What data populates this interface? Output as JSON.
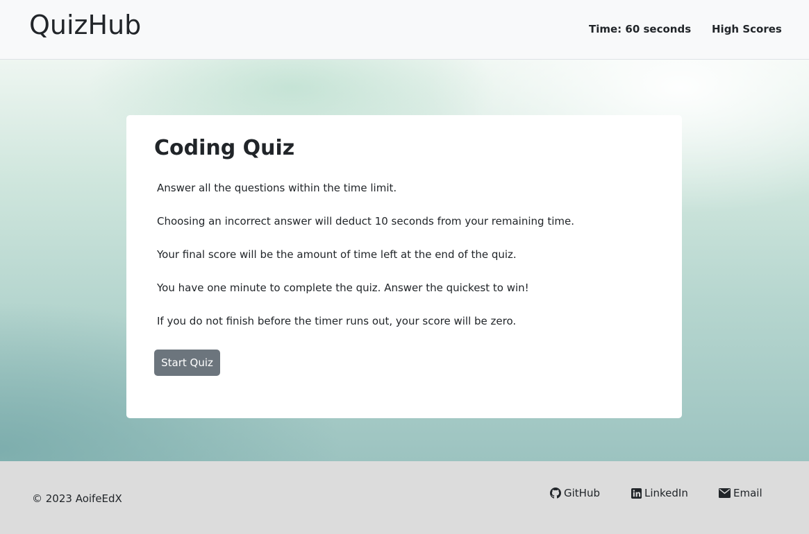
{
  "header": {
    "brand": "QuizHub",
    "timer_text": "Time: 60 seconds",
    "high_scores_label": "High Scores"
  },
  "quiz": {
    "title": "Coding Quiz",
    "rules": [
      "Answer all the questions within the time limit.",
      "Choosing an incorrect answer will deduct 10 seconds from your remaining time.",
      "Your final score will be the amount of time left at the end of the quiz.",
      "You have one minute to complete the quiz. Answer the quickest to win!",
      "If you do not finish before the timer runs out, your score will be zero."
    ],
    "start_label": "Start Quiz"
  },
  "footer": {
    "copyright": "© 2023 AoifeEdX",
    "links": [
      {
        "label": "GitHub",
        "icon": "github-icon"
      },
      {
        "label": "LinkedIn",
        "icon": "linkedin-icon"
      },
      {
        "label": "Email",
        "icon": "envelope-icon"
      }
    ]
  },
  "colors": {
    "navbar_bg": "#f8f9fa",
    "button_bg": "#6c757d",
    "footer_bg": "#dcdcdc"
  }
}
